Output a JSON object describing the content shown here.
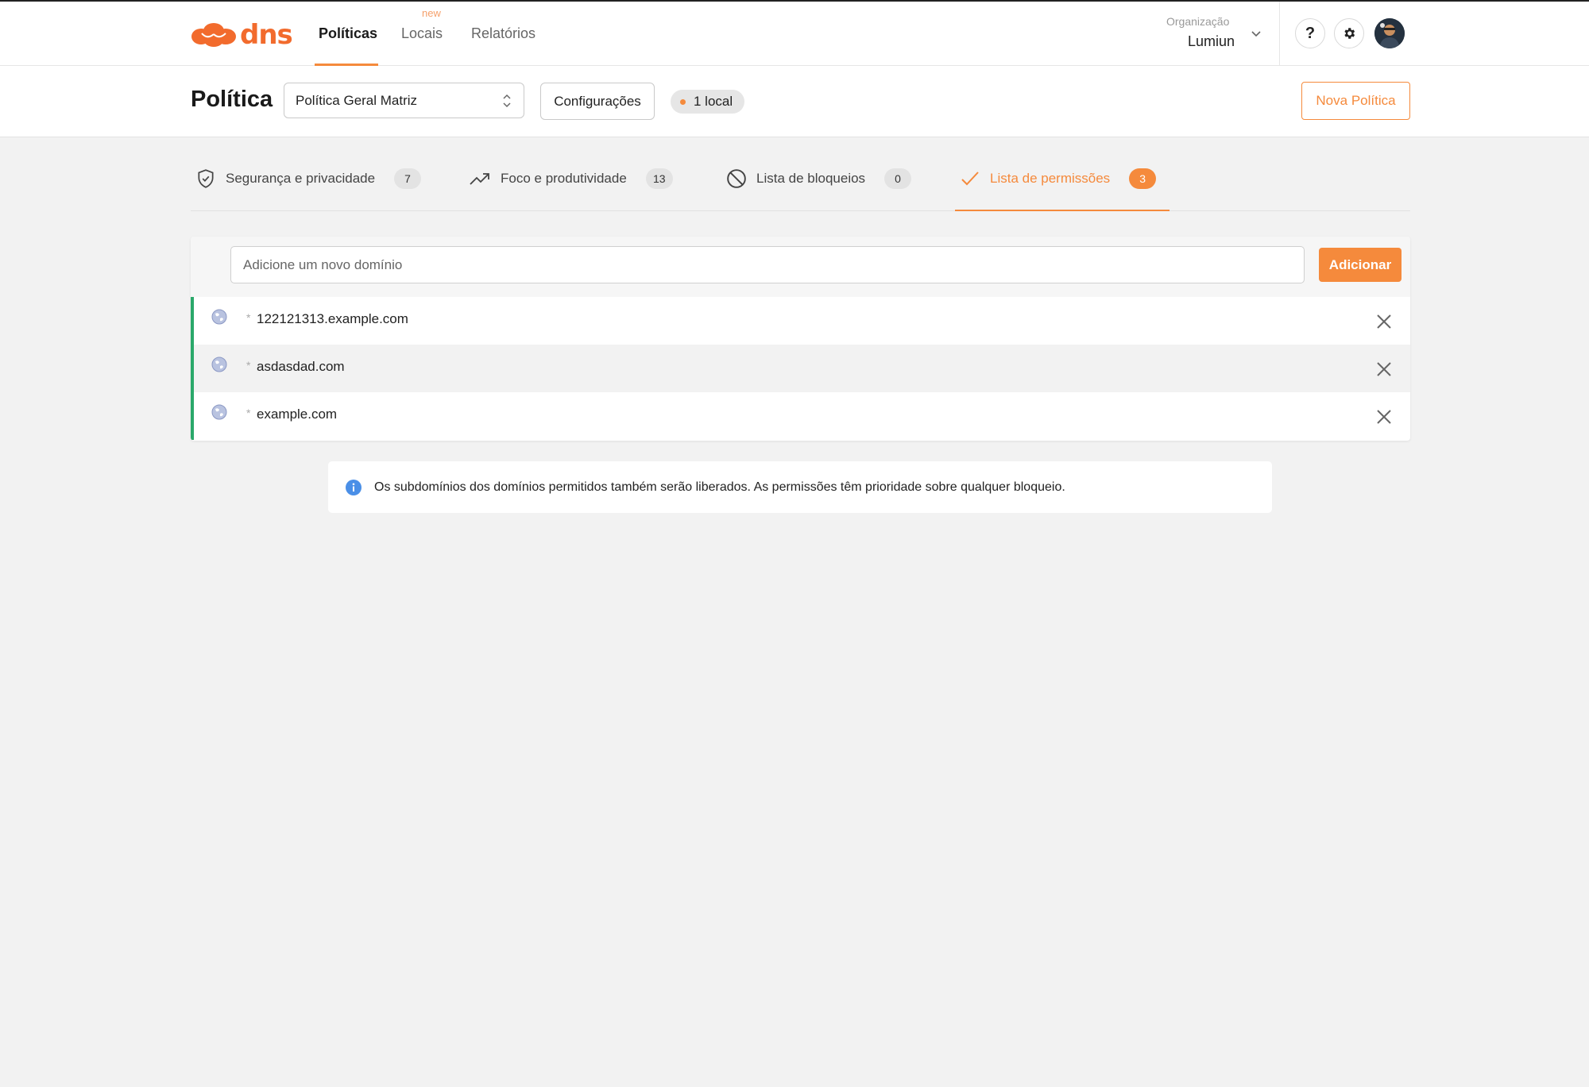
{
  "brand": {
    "logo_text": "dns",
    "accent_color": "#f58a3c",
    "logo_color": "#f26b2d"
  },
  "nav": {
    "items": [
      {
        "label": "Políticas",
        "active": true
      },
      {
        "label": "Locais",
        "badge": "new"
      },
      {
        "label": "Relatórios"
      }
    ]
  },
  "org": {
    "label": "Organização",
    "name": "Lumiun"
  },
  "header_actions": {
    "help_label": "?",
    "icons": [
      "help-icon",
      "gear-icon",
      "avatar"
    ]
  },
  "policy": {
    "title": "Política",
    "selected": "Política Geral Matriz",
    "config_label": "Configurações",
    "local_badge": "1 local",
    "new_label": "Nova Política"
  },
  "tabs": [
    {
      "label": "Segurança e privacidade",
      "count": "7",
      "icon": "shield-check-icon"
    },
    {
      "label": "Foco e produtividade",
      "count": "13",
      "icon": "trending-up-icon"
    },
    {
      "label": "Lista de bloqueios",
      "count": "0",
      "icon": "block-icon"
    },
    {
      "label": "Lista de permissões",
      "count": "3",
      "icon": "check-icon",
      "active": true
    }
  ],
  "allowlist": {
    "placeholder": "Adicione um novo domínio",
    "add_label": "Adicionar",
    "status_color": "#2aa86a",
    "domains": [
      {
        "prefix": "*",
        "domain": "122121313.example.com"
      },
      {
        "prefix": "*",
        "domain": "asdasdad.com"
      },
      {
        "prefix": "*",
        "domain": "example.com"
      }
    ]
  },
  "info": {
    "icon": "info-icon",
    "text": "Os subdomínios dos domínios permitidos também serão liberados. As permissões têm prioridade sobre qualquer bloqueio."
  }
}
